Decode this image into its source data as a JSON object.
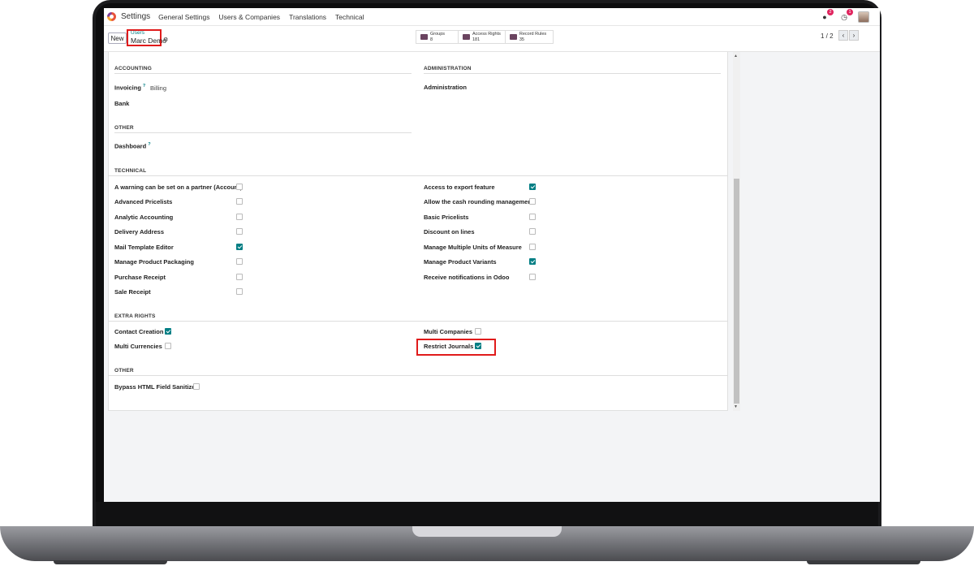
{
  "navbar": {
    "app": "Settings",
    "menu": [
      "General Settings",
      "Users & Companies",
      "Translations",
      "Technical"
    ],
    "badges": {
      "messages": "2",
      "activities": "1"
    }
  },
  "control": {
    "new_label": "New",
    "breadcrumb_parent": "Users",
    "breadcrumb_current": "Marc Demo",
    "smart_buttons": [
      {
        "label": "Groups",
        "count": "8",
        "icon": "users-icon"
      },
      {
        "label": "Access Rights",
        "count": "181",
        "icon": "list-icon"
      },
      {
        "label": "Record Rules",
        "count": "35",
        "icon": "list-icon"
      }
    ],
    "pager": "1 / 2"
  },
  "sections": {
    "accounting": "ACCOUNTING",
    "administration": "ADMINISTRATION",
    "other": "OTHER",
    "technical": "TECHNICAL",
    "extra_rights": "EXTRA RIGHTS",
    "other2": "OTHER"
  },
  "accounting": {
    "invoicing_label": "Invoicing",
    "invoicing_value": "Billing",
    "bank_label": "Bank"
  },
  "administration": {
    "label": "Administration"
  },
  "other": {
    "dashboard_label": "Dashboard"
  },
  "technical": {
    "left": [
      {
        "label": "A warning can be set on a partner (Account)",
        "checked": false
      },
      {
        "label": "Advanced Pricelists",
        "checked": false
      },
      {
        "label": "Analytic Accounting",
        "checked": false
      },
      {
        "label": "Delivery Address",
        "checked": false
      },
      {
        "label": "Mail Template Editor",
        "checked": true
      },
      {
        "label": "Manage Product Packaging",
        "checked": false
      },
      {
        "label": "Purchase Receipt",
        "checked": false
      },
      {
        "label": "Sale Receipt",
        "checked": false
      }
    ],
    "right": [
      {
        "label": "Access to export feature",
        "checked": true
      },
      {
        "label": "Allow the cash rounding management",
        "checked": false
      },
      {
        "label": "Basic Pricelists",
        "checked": false
      },
      {
        "label": "Discount on lines",
        "checked": false
      },
      {
        "label": "Manage Multiple Units of Measure",
        "checked": false
      },
      {
        "label": "Manage Product Variants",
        "checked": true
      },
      {
        "label": "Receive notifications in Odoo",
        "checked": false
      }
    ]
  },
  "extra_rights": {
    "contact_creation": {
      "label": "Contact Creation",
      "checked": true
    },
    "multi_currencies": {
      "label": "Multi Currencies",
      "checked": false
    },
    "multi_companies": {
      "label": "Multi Companies",
      "checked": false
    },
    "restrict_journals": {
      "label": "Restrict Journals",
      "checked": true
    }
  },
  "other2": {
    "bypass": {
      "label": "Bypass HTML Field Sanitize",
      "checked": false
    }
  },
  "colors": {
    "accent": "#017e84",
    "highlight": "#e01b1b",
    "brand": "#6b4460"
  }
}
